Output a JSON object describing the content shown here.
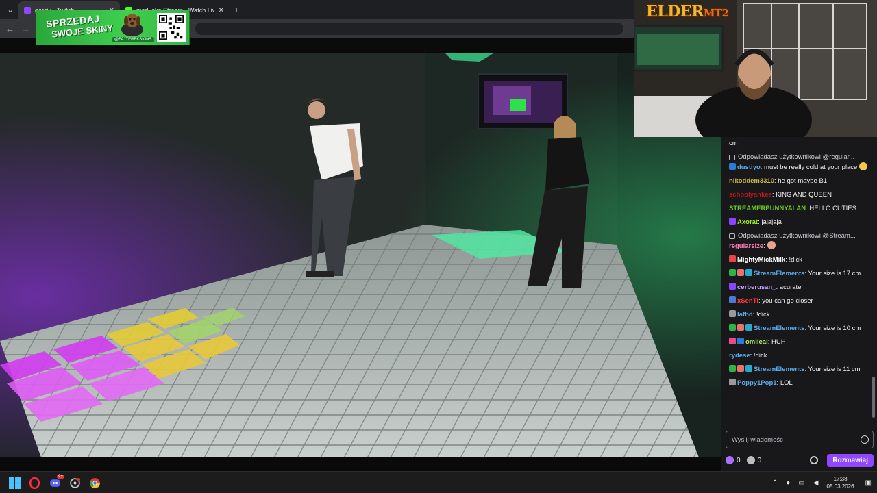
{
  "browser": {
    "tabs": [
      {
        "title": "gorcik - Twitch",
        "active": true
      },
      {
        "title": "medusko Stream - Watch Live o",
        "active": false
      }
    ],
    "tab_close": "✕",
    "new_tab": "+",
    "back": "←",
    "forward": "→"
  },
  "ad": {
    "line1": "SPRZEDAJ",
    "line2": "SWOJE SKINY",
    "handle": "@FAJTEREKSKINS"
  },
  "webcam": {
    "logo_main": "ELDER",
    "logo_suffix": "MT2"
  },
  "chat": {
    "messages": [
      {
        "type": "cont",
        "text": "cm"
      },
      {
        "type": "reply",
        "text": "Odpowiadasz użytkownikowi @regular..."
      },
      {
        "user": "dustiyo",
        "color": "#5aa9e6",
        "badges": [
          "#2a7bd5"
        ],
        "text": ": must be really cold at your place",
        "emote": "#f2c94c"
      },
      {
        "user": "nikoddem3310",
        "color": "#c8b84b",
        "text": ": he got maybe B1"
      },
      {
        "user": "schoolyankee",
        "color": "#b81818",
        "text": ": KING AND QUEEN"
      },
      {
        "user": "STREAMERPUNNYALAN",
        "color": "#6ecb2a",
        "text": ": HELLO CUTIES"
      },
      {
        "user": "Axorat",
        "color": "#9ef01a",
        "badges": [
          "#8a44ff"
        ],
        "text": ": jajajaja"
      },
      {
        "type": "reply",
        "text": "Odpowiadasz użytkownikowi @Stream..."
      },
      {
        "user": "regularsize",
        "color": "#ff7eb6",
        "text": ":",
        "emote": "#e8a48a"
      },
      {
        "user": "MightyMickMilk",
        "color": "#ffffff",
        "badges": [
          "#e84545"
        ],
        "text": ": !dick"
      },
      {
        "user": "StreamElements",
        "color": "#5aa9e6",
        "badges": [
          "#2db34a",
          "#e8736c",
          "#29a8c9"
        ],
        "text": ": Your size is 17 cm"
      },
      {
        "user": "cerberusan_",
        "color": "#c9a0ff",
        "badges": [
          "#8a44ff"
        ],
        "text": ": acurate"
      },
      {
        "user": "xSenTi",
        "color": "#ff3b3b",
        "badges": [
          "#4a7bd5"
        ],
        "text": ": you can go closer"
      },
      {
        "user": "lafhd",
        "color": "#5aa9e6",
        "badges": [
          "#9a9a9a"
        ],
        "text": ": !dick"
      },
      {
        "user": "StreamElements",
        "color": "#5aa9e6",
        "badges": [
          "#2db34a",
          "#e8736c",
          "#29a8c9"
        ],
        "text": ": Your size is 10 cm"
      },
      {
        "user": "omileal",
        "color": "#b8f06a",
        "badges": [
          "#e84b8a",
          "#2a7bd5"
        ],
        "text": ": HUH"
      },
      {
        "user": "rydese",
        "color": "#5aa9e6",
        "text": ": !dick"
      },
      {
        "user": "StreamElements",
        "color": "#5aa9e6",
        "badges": [
          "#2db34a",
          "#e8736c",
          "#29a8c9"
        ],
        "text": ": Your size is 11 cm"
      },
      {
        "user": "Poppy1Pop1",
        "color": "#5aa9e6",
        "badges": [
          "#9a9a9a"
        ],
        "text": ": LOL"
      }
    ],
    "input_placeholder": "Wyślij wiadomość",
    "points_a": "0",
    "points_b": "0",
    "send_label": "Rozmawiaj"
  },
  "taskbar": {
    "discord_badge": "9+",
    "time": "17:38",
    "date": "05.03.2026"
  }
}
